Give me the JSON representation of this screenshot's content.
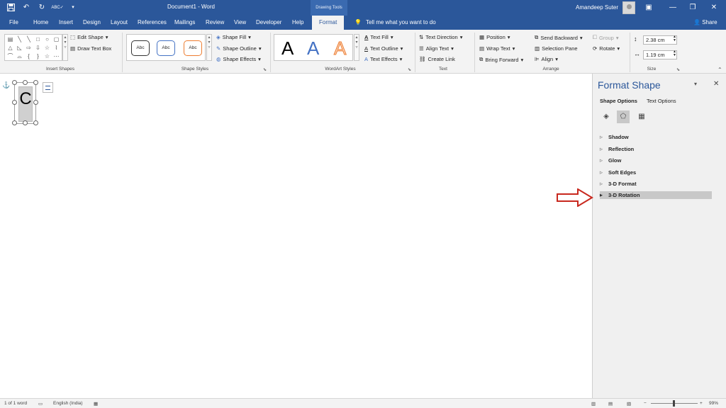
{
  "title_bar": {
    "document_title": "Document1 - Word",
    "context_tab_group": "Drawing Tools",
    "user_name": "Amandeep Suter",
    "qat_icons": [
      "save-icon",
      "undo-icon",
      "redo-icon",
      "spelling-icon",
      "customize-icon"
    ],
    "window_controls": [
      "ribbon-display-icon",
      "minimize-icon",
      "restore-icon",
      "close-icon"
    ]
  },
  "tabs": {
    "file": "File",
    "home": "Home",
    "insert": "Insert",
    "design": "Design",
    "layout": "Layout",
    "references": "References",
    "mailings": "Mailings",
    "review": "Review",
    "view": "View",
    "developer": "Developer",
    "help": "Help",
    "format": "Format",
    "tell_me": "Tell me what you want to do",
    "share": "Share"
  },
  "ribbon": {
    "insert_shapes": {
      "label": "Insert Shapes",
      "edit_shape": "Edit Shape",
      "draw_text_box": "Draw Text Box"
    },
    "shape_styles": {
      "label": "Shape Styles",
      "gallery": [
        "Abc",
        "Abc",
        "Abc"
      ],
      "shape_fill": "Shape Fill",
      "shape_outline": "Shape Outline",
      "shape_effects": "Shape Effects"
    },
    "wordart_styles": {
      "label": "WordArt Styles",
      "gallery": [
        "A",
        "A",
        "A"
      ],
      "text_fill": "Text Fill",
      "text_outline": "Text Outline",
      "text_effects": "Text Effects"
    },
    "text": {
      "label": "Text",
      "text_direction": "Text Direction",
      "align_text": "Align Text",
      "create_link": "Create Link"
    },
    "arrange": {
      "label": "Arrange",
      "position": "Position",
      "wrap_text": "Wrap Text",
      "bring_forward": "Bring Forward",
      "send_backward": "Send Backward",
      "selection_pane": "Selection Pane",
      "align": "Align",
      "group": "Group",
      "rotate": "Rotate"
    },
    "size": {
      "label": "Size",
      "height": "2.38 cm",
      "width": "1.19 cm"
    }
  },
  "document": {
    "shape_text": "C"
  },
  "format_pane": {
    "title": "Format Shape",
    "tab_shape_options": "Shape Options",
    "tab_text_options": "Text Options",
    "category_icons": [
      "fill-line-icon",
      "effects-icon",
      "size-properties-icon"
    ],
    "sections": [
      "Shadow",
      "Reflection",
      "Glow",
      "Soft Edges",
      "3-D Format",
      "3-D Rotation"
    ]
  },
  "status_bar": {
    "word_count": "1 of 1 word",
    "language": "English (India)",
    "zoom": "99%"
  },
  "colors": {
    "accent": "#2b579a",
    "arrow": "#c8281e"
  }
}
